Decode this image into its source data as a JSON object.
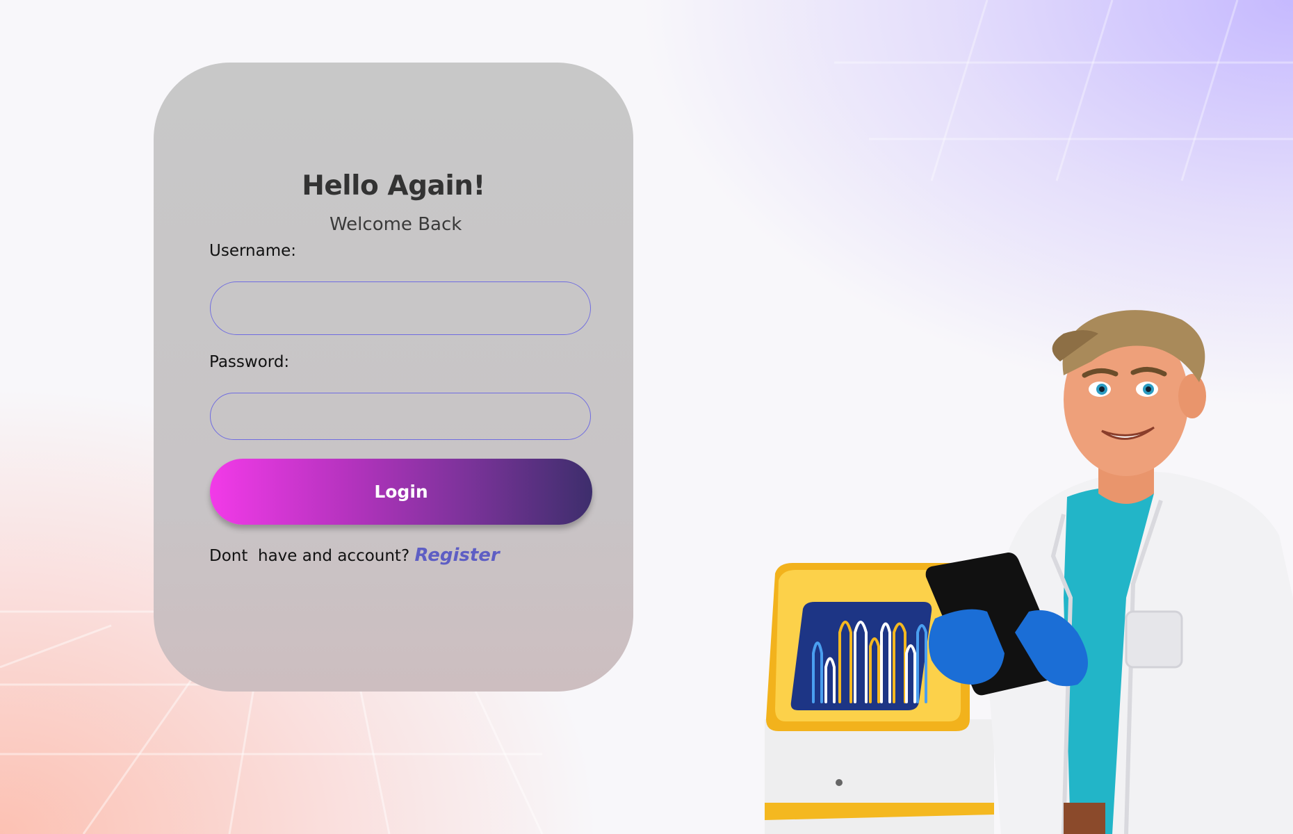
{
  "login_card": {
    "title": "Hello Again!",
    "subtitle": "Welcome Back",
    "username_label": "Username:",
    "username_value": "",
    "password_label": "Password:",
    "password_value": "",
    "login_button_label": "Login",
    "register_prompt": "Dont  have and account? ",
    "register_link_label": "Register"
  },
  "colors": {
    "card_background": "#c9c9c9",
    "input_border": "#6f6ce0",
    "button_gradient_start": "#f23ae8",
    "button_gradient_end": "#3d2e6c",
    "register_link": "#5e5ec4",
    "background_top_right": "#c3b6ff",
    "background_bottom_left": "#fcbeaf"
  },
  "illustration": {
    "icon": "scientist-with-tablet-illustration"
  }
}
